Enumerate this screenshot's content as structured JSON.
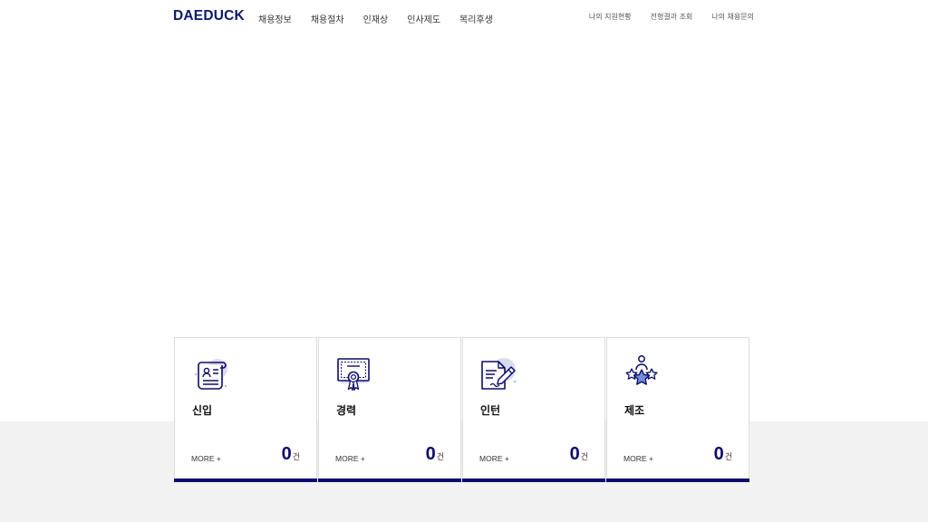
{
  "brand": {
    "logo": "DAEDUCK"
  },
  "nav": {
    "main": [
      "채용정보",
      "채용절차",
      "인재상",
      "인사제도",
      "복리후생"
    ],
    "util": [
      "나의 지원현황",
      "전형결과 조회",
      "나의 채용문의"
    ]
  },
  "cards": [
    {
      "title": "신입",
      "more": "MORE +",
      "count": "0",
      "unit": "건",
      "icon": "resume-scroll-icon"
    },
    {
      "title": "경력",
      "more": "MORE +",
      "count": "0",
      "unit": "건",
      "icon": "certificate-icon"
    },
    {
      "title": "인턴",
      "more": "MORE +",
      "count": "0",
      "unit": "건",
      "icon": "document-pen-icon"
    },
    {
      "title": "제조",
      "more": "MORE +",
      "count": "0",
      "unit": "건",
      "icon": "person-stars-icon"
    }
  ],
  "colors": {
    "brand": "#0c1a6b",
    "bar": "#0c0d6b",
    "icon_fill": "#d9dcef",
    "band": "#f2f2f2"
  }
}
